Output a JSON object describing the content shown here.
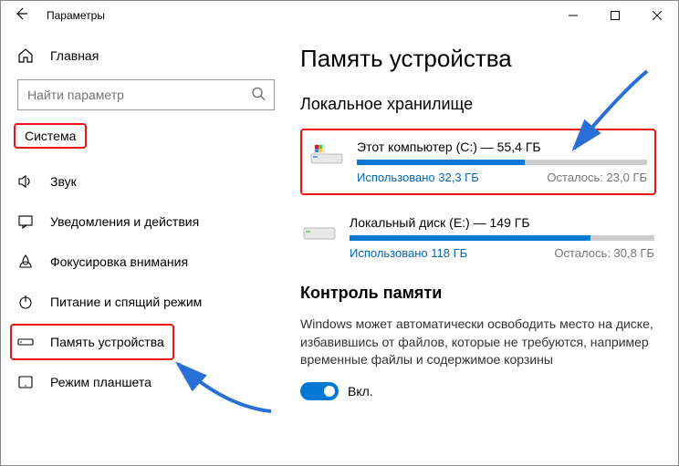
{
  "window": {
    "title": "Параметры"
  },
  "sidebar": {
    "home": "Главная",
    "search_placeholder": "Найти параметр",
    "category": "Система",
    "items": [
      {
        "label": "Звук"
      },
      {
        "label": "Уведомления и действия"
      },
      {
        "label": "Фокусировка внимания"
      },
      {
        "label": "Питание и спящий режим"
      },
      {
        "label": "Память устройства"
      },
      {
        "label": "Режим планшета"
      }
    ]
  },
  "main": {
    "title": "Память устройства",
    "local_storage_title": "Локальное хранилище",
    "drives": [
      {
        "title": "Этот компьютер (C:) — 55,4 ГБ",
        "used": "Использовано 32,3 ГБ",
        "free": "Осталось: 23,0 ГБ",
        "fill_pct": 58
      },
      {
        "title": "Локальный диск (E:) — 149 ГБ",
        "used": "Использовано 118 ГБ",
        "free": "Осталось: 30,8 ГБ",
        "fill_pct": 79
      }
    ],
    "storage_sense": {
      "title": "Контроль памяти",
      "desc": "Windows может автоматически освободить место на диске, избавившись от файлов, которые не требуются, например временные файлы и содержимое корзины",
      "toggle_label": "Вкл."
    }
  }
}
